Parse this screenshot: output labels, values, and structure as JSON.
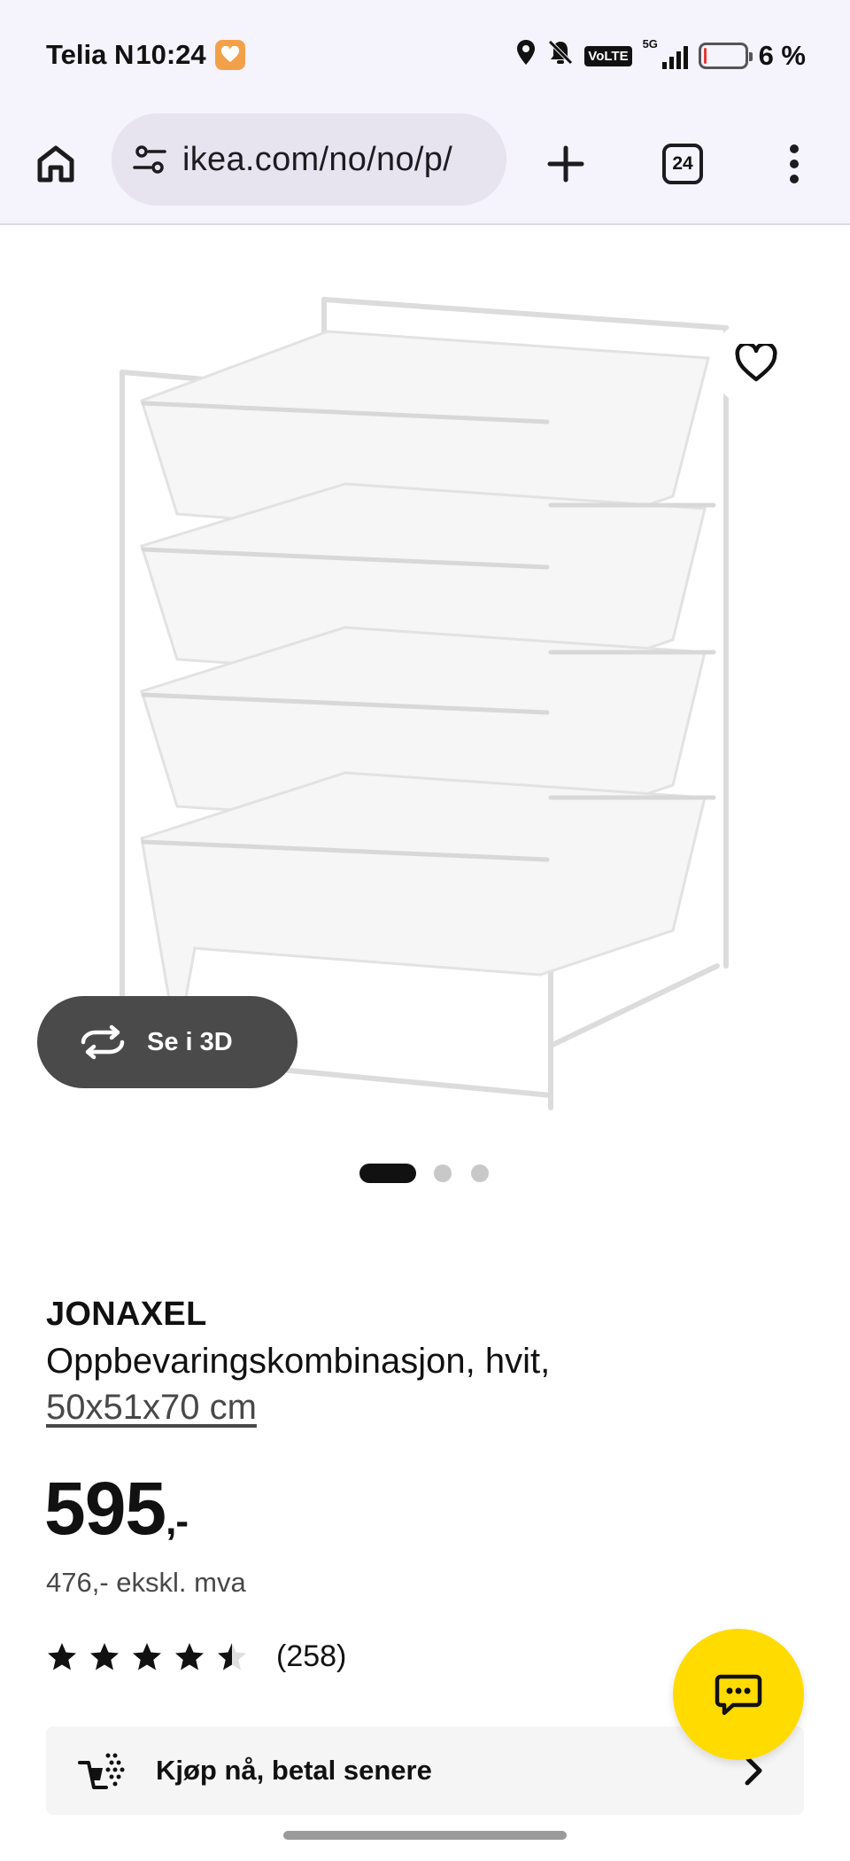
{
  "status_bar": {
    "carrier": "Telia N",
    "time": "10:24",
    "network_badge": "VoLTE",
    "network_gen": "5G",
    "battery_percent": "6 %",
    "battery_level": 0.06,
    "battery_color": "#e53935",
    "icons": [
      "location-icon",
      "bell-muted-icon",
      "signal-icon",
      "battery-icon"
    ]
  },
  "browser": {
    "url": "ikea.com/no/no/p/",
    "tab_count": "24",
    "icons": [
      "home-icon",
      "site-settings-icon",
      "new-tab-icon",
      "tab-switcher-icon",
      "overflow-menu-icon"
    ]
  },
  "product_image": {
    "view_3d_label": "Se i 3D",
    "carousel_total": 3,
    "carousel_active": 1,
    "icons": [
      "favorite-heart-icon",
      "rotate-3d-icon"
    ]
  },
  "product": {
    "name": "JONAXEL",
    "description": "Oppbevaringskombinasjon, hvit,",
    "size": "50x51x70 cm",
    "price": "595",
    "price_suffix": ",-",
    "price_ex_vat": "476,- ekskl. mva",
    "rating_value": 4.5,
    "rating_max": 5,
    "review_count": "(258)"
  },
  "payment": {
    "label": "Kjøp nå, betal senere",
    "icons": [
      "buy-now-pay-later-icon",
      "chevron-right-icon"
    ]
  },
  "chat": {
    "icon": "chat-icon",
    "accent": "#ffdb00"
  }
}
